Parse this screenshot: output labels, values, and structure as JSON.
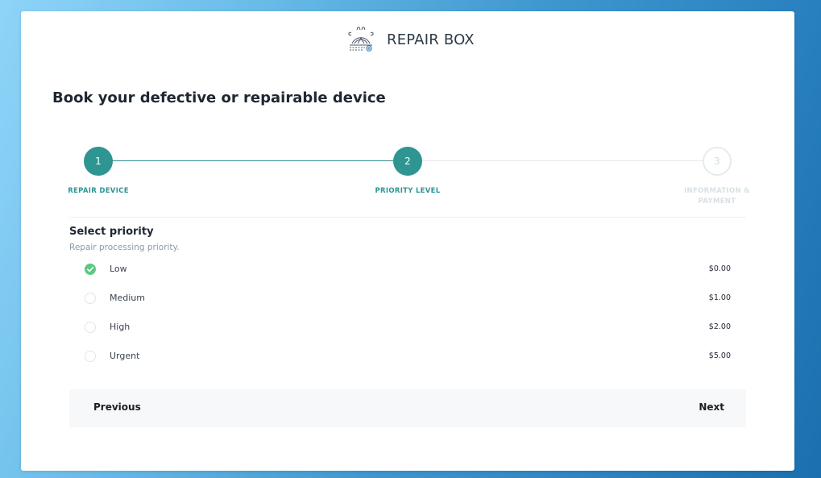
{
  "brand": {
    "name": "REPAIR BOX",
    "logo_icon": "gear-tools-icon"
  },
  "page": {
    "title": "Book your defective or repairable device"
  },
  "stepper": {
    "steps": [
      {
        "number": "1",
        "label": "REPAIR DEVICE",
        "state": "completed"
      },
      {
        "number": "2",
        "label": "PRIORITY LEVEL",
        "state": "current"
      },
      {
        "number": "3",
        "label": "INFORMATION & PAYMENT",
        "state": "upcoming"
      }
    ]
  },
  "priority": {
    "title": "Select priority",
    "subtitle": "Repair processing priority.",
    "selected": "Low",
    "options": [
      {
        "label": "Low",
        "price": "$0.00"
      },
      {
        "label": "Medium",
        "price": "$1.00"
      },
      {
        "label": "High",
        "price": "$2.00"
      },
      {
        "label": "Urgent",
        "price": "$5.00"
      }
    ]
  },
  "nav": {
    "previous_label": "Previous",
    "next_label": "Next"
  },
  "colors": {
    "accent": "#2e9592",
    "check": "#5dc983",
    "footer_bg": "#f6f8fa"
  }
}
